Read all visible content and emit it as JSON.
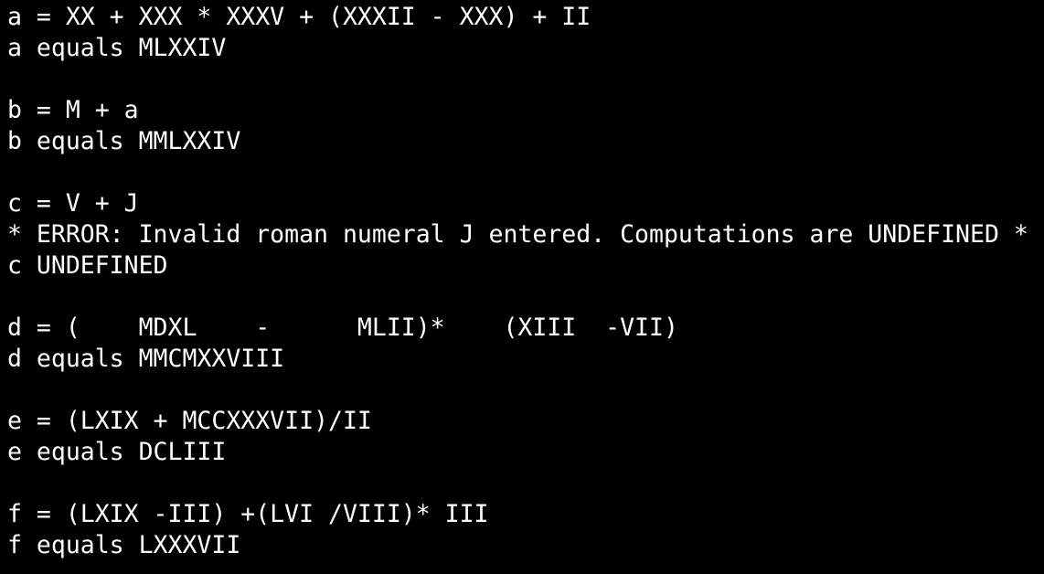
{
  "terminal": {
    "lines": [
      "a = XX + XXX * XXXV + (XXXII - XXX) + II",
      "a equals MLXXIV",
      "",
      "b = M + a",
      "b equals MMLXXIV",
      "",
      "c = V + J",
      "* ERROR: Invalid roman numeral J entered. Computations are UNDEFINED *",
      "c UNDEFINED",
      "",
      "d = (    MDXL    -      MLII)*    (XIII  -VII)",
      "d equals MMCMXXVIII",
      "",
      "e = (LXIX + MCCXXXVII)/II",
      "e equals DCLIII",
      "",
      "f = (LXIX -III) +(LVI /VIII)* III",
      "f equals LXXXVII"
    ]
  }
}
